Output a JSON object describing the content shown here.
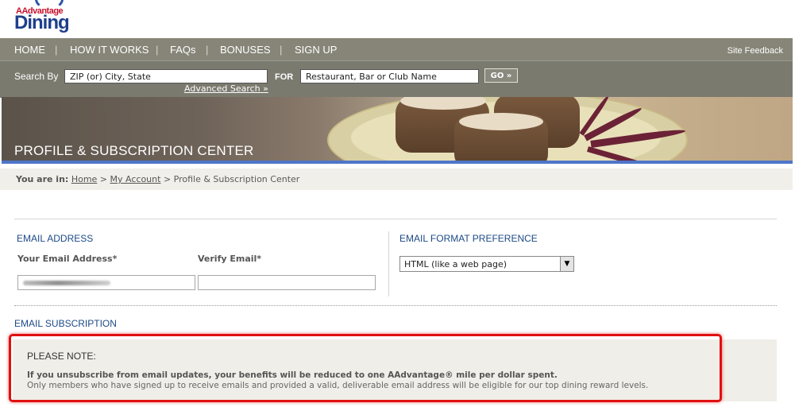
{
  "logo": {
    "small": "AAdvantage",
    "big": "Dining"
  },
  "nav": {
    "items": [
      "HOME",
      "HOW IT WORKS",
      "FAQs",
      "BONUSES",
      "SIGN UP"
    ],
    "site_feedback": "Site Feedback"
  },
  "search": {
    "label": "Search By",
    "location_value": "ZIP (or) City, State",
    "for_label": "FOR",
    "name_value": "Restaurant, Bar or Club Name",
    "go_label": "GO",
    "advanced": "Advanced Search »"
  },
  "banner": {
    "title": "PROFILE & SUBSCRIPTION CENTER"
  },
  "breadcrumb": {
    "prefix": "You are in:",
    "home": "Home",
    "my_account": "My Account",
    "current": "Profile & Subscription Center",
    "separator": ">"
  },
  "email_address": {
    "heading": "EMAIL ADDRESS",
    "your_email_label": "Your Email Address*",
    "verify_label": "Verify Email*"
  },
  "format_pref": {
    "heading": "EMAIL FORMAT PREFERENCE",
    "selected": "HTML (like a web page)"
  },
  "subscription": {
    "heading": "EMAIL SUBSCRIPTION",
    "note_title": "PLEASE NOTE:",
    "note_bold": "If you unsubscribe from email updates, your benefits will be reduced to one AAdvantage® mile per dollar spent.",
    "note_line": "Only members who have signed up to receive emails and provided a valid, deliverable email address will be eligible for our top dining reward levels."
  },
  "colors": {
    "nav_bg": "#868578",
    "search_bg": "#7b7a6f",
    "heading_blue": "#1c4a86",
    "highlight_red": "#e01010"
  }
}
